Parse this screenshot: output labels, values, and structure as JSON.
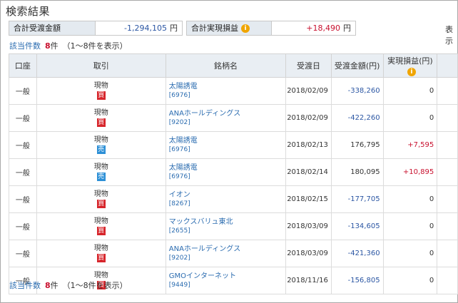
{
  "title": "検索結果",
  "summary": {
    "delivery_label": "合計受渡金額",
    "delivery_value": "-1,294,105",
    "delivery_unit": "円",
    "pnl_label": "合計実現損益",
    "pnl_value": "+18,490",
    "pnl_unit": "円",
    "right_cut_text": "表示"
  },
  "count": {
    "label": "該当件数",
    "value": "8",
    "suffix": "件",
    "range": "（1～8件を表示）"
  },
  "table": {
    "headers": [
      "口座",
      "取引",
      "銘柄名",
      "受渡日",
      "受渡金額(円)",
      "実現損益(円)"
    ],
    "rows": [
      {
        "account": "一般",
        "trade": "現物",
        "side": "買",
        "name": "太陽誘電",
        "code": "[6976]",
        "date": "2018/02/09",
        "amount": "-338,260",
        "pnl": "0"
      },
      {
        "account": "一般",
        "trade": "現物",
        "side": "買",
        "name": "ANAホールディングス",
        "code": "[9202]",
        "date": "2018/02/09",
        "amount": "-422,260",
        "pnl": "0"
      },
      {
        "account": "一般",
        "trade": "現物",
        "side": "売",
        "name": "太陽誘電",
        "code": "[6976]",
        "date": "2018/02/13",
        "amount": "176,795",
        "pnl": "+7,595"
      },
      {
        "account": "一般",
        "trade": "現物",
        "side": "売",
        "name": "太陽誘電",
        "code": "[6976]",
        "date": "2018/02/14",
        "amount": "180,095",
        "pnl": "+10,895"
      },
      {
        "account": "一般",
        "trade": "現物",
        "side": "買",
        "name": "イオン",
        "code": "[8267]",
        "date": "2018/02/15",
        "amount": "-177,705",
        "pnl": "0"
      },
      {
        "account": "一般",
        "trade": "現物",
        "side": "買",
        "name": "マックスバリュ東北",
        "code": "[2655]",
        "date": "2018/03/09",
        "amount": "-134,605",
        "pnl": "0"
      },
      {
        "account": "一般",
        "trade": "現物",
        "side": "買",
        "name": "ANAホールディングス",
        "code": "[9202]",
        "date": "2018/03/09",
        "amount": "-421,360",
        "pnl": "0"
      },
      {
        "account": "一般",
        "trade": "現物",
        "side": "買",
        "name": "GMOインターネット",
        "code": "[9449]",
        "date": "2018/11/16",
        "amount": "-156,805",
        "pnl": "0"
      }
    ]
  },
  "colors": {
    "header_bg": "#e9eef3",
    "buy_badge": "#d7262c",
    "sell_badge": "#2c8fd6",
    "link": "#2b6cb0",
    "negative": "#2b56a3",
    "positive": "#c8102e",
    "info_icon": "#f0a500"
  },
  "icons": {
    "info": "info-icon"
  }
}
